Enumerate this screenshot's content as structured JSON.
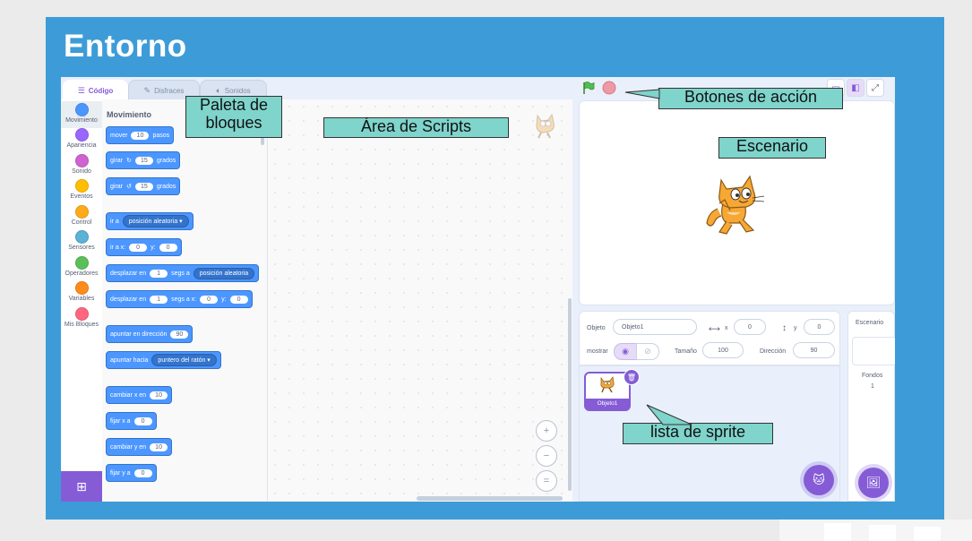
{
  "slide": {
    "title": "Entorno"
  },
  "tabs": [
    {
      "label": "Código",
      "icon": "code-icon"
    },
    {
      "label": "Disfraces",
      "icon": "brush-icon"
    },
    {
      "label": "Sonidos",
      "icon": "speaker-icon"
    }
  ],
  "categories": [
    {
      "label": "Movimiento",
      "color": "#4c97ff"
    },
    {
      "label": "Apariencia",
      "color": "#9966ff"
    },
    {
      "label": "Sonido",
      "color": "#cf63cf"
    },
    {
      "label": "Eventos",
      "color": "#ffbf00"
    },
    {
      "label": "Control",
      "color": "#ffab19"
    },
    {
      "label": "Sensores",
      "color": "#5cb1d6"
    },
    {
      "label": "Operadores",
      "color": "#59c059"
    },
    {
      "label": "Variables",
      "color": "#ff8c1a"
    },
    {
      "label": "Mis Bloques",
      "color": "#ff6680"
    }
  ],
  "palette": {
    "heading": "Movimiento",
    "blocks": {
      "mover": {
        "a": "mover",
        "v": "10",
        "b": "pasos"
      },
      "girar_r": {
        "a": "girar",
        "v": "15",
        "b": "grados"
      },
      "girar_l": {
        "a": "girar",
        "v": "15",
        "b": "grados"
      },
      "ir_a": {
        "a": "ir a",
        "drop": "posición aleatoria"
      },
      "ir_a_xy": {
        "a": "ir a x:",
        "x": "0",
        "yl": "y:",
        "y": "0"
      },
      "desplazar": {
        "a": "desplazar en",
        "v": "1",
        "b": "segs a",
        "drop": "posición aleatoria"
      },
      "desplazar_xy": {
        "a": "desplazar en",
        "v": "1",
        "b": "segs a x:",
        "x": "0",
        "yl": "y:",
        "y": "0"
      },
      "apuntar_dir": {
        "a": "apuntar en dirección",
        "v": "90"
      },
      "apuntar_hacia": {
        "a": "apuntar hacia",
        "drop": "puntero del ratón"
      },
      "cambiar_x": {
        "a": "cambiar x en",
        "v": "10"
      },
      "fijar_x": {
        "a": "fijar x a",
        "v": "0"
      },
      "cambiar_y": {
        "a": "cambiar y en",
        "v": "10"
      },
      "fijar_y": {
        "a": "fijar y a",
        "v": "0"
      }
    }
  },
  "zoom": {
    "in": "+",
    "out": "−",
    "reset": "="
  },
  "sprite_info": {
    "objeto_label": "Objeto",
    "objeto_value": "Objeto1",
    "x_label": "x",
    "x_value": "0",
    "y_label": "y",
    "y_value": "0",
    "mostrar_label": "mostrar",
    "tamano_label": "Tamaño",
    "tamano_value": "100",
    "direccion_label": "Dirección",
    "direccion_value": "90"
  },
  "sprite_list": [
    {
      "name": "Objeto1"
    }
  ],
  "stage_panel": {
    "title": "Escenario",
    "fondos_label": "Fondos",
    "fondos_count": "1"
  },
  "annotations": {
    "paleta": "Paleta de bloques",
    "scripts": "Área de Scripts",
    "botones": "Botones de acción",
    "escenario": "Escenario",
    "sprites": "lista de sprite"
  },
  "colors": {
    "slide_bg": "#3d9cd8",
    "accent": "#855cd6",
    "motion": "#4c97ff",
    "callout": "#7fd4cc"
  }
}
